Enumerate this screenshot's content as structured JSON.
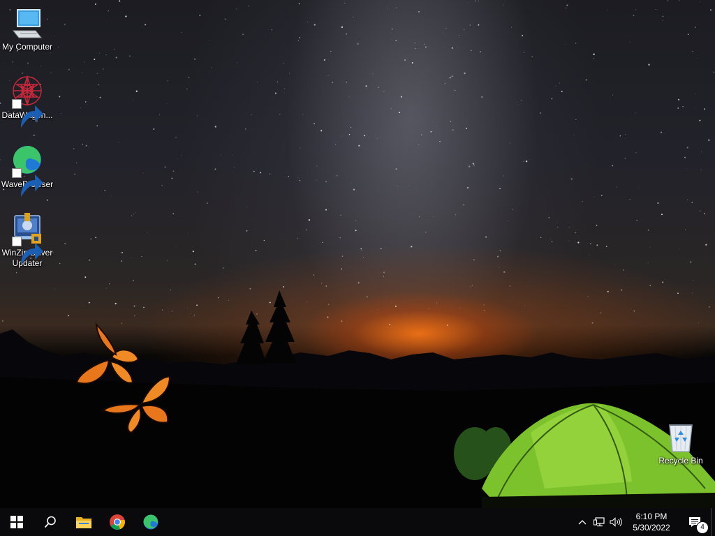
{
  "desktop": {
    "icons": [
      {
        "label": "My Computer",
        "icon": "computer-icon"
      },
      {
        "label": "DataWagon...",
        "icon": "datawagon-icon"
      },
      {
        "label": "WaveBrowser",
        "icon": "wavebrowser-icon"
      },
      {
        "label": "WinZip Driver Updater",
        "icon": "winzip-driver-updater-icon"
      },
      {
        "label": "Recycle Bin",
        "icon": "recycle-bin-icon"
      }
    ]
  },
  "taskbar": {
    "start": {
      "icon": "windows-logo-icon"
    },
    "search": {
      "icon": "search-icon"
    },
    "pinned": [
      {
        "name": "File Explorer",
        "icon": "folder-icon"
      },
      {
        "name": "Google Chrome",
        "icon": "chrome-icon"
      },
      {
        "name": "WaveBrowser",
        "icon": "wavebrowser-icon"
      }
    ],
    "tray": {
      "icons": [
        "chevron-up-icon",
        "network-icon",
        "volume-icon"
      ],
      "time": "6:10 PM",
      "date": "5/30/2022",
      "notifications_count": "4"
    }
  },
  "colors": {
    "taskbar": "#0a0a0c",
    "tent": "#8cd23c",
    "sunset": "#ff7a1a"
  }
}
